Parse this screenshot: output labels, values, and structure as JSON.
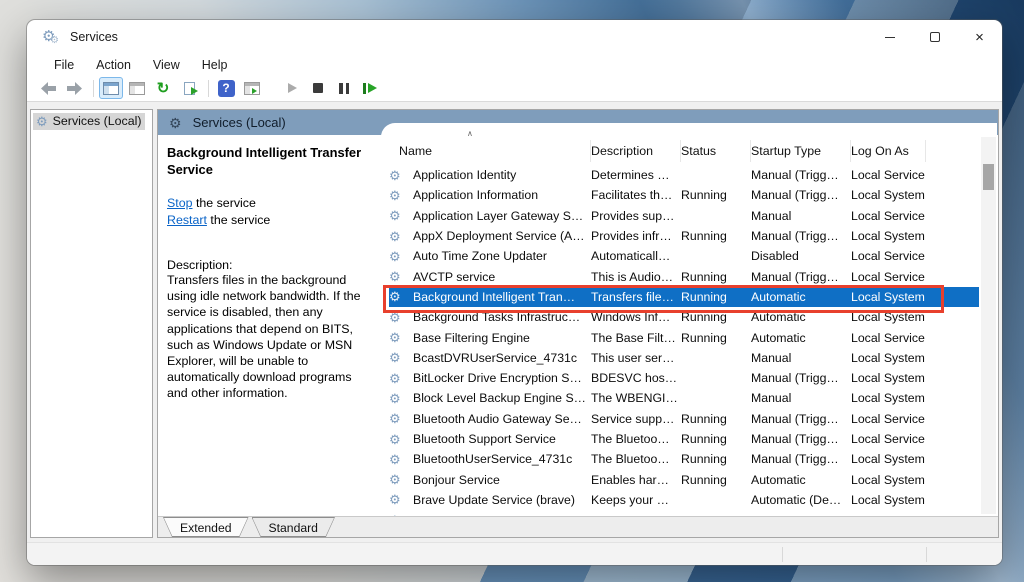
{
  "window": {
    "title": "Services",
    "controls": {
      "minimize": "minimize",
      "maximize": "maximize",
      "close": "×"
    }
  },
  "menu": {
    "items": [
      "File",
      "Action",
      "View",
      "Help"
    ]
  },
  "toolbar": {
    "icons": [
      "back-arrow",
      "forward-arrow",
      "show-console-tree",
      "properties-window",
      "refresh",
      "export-list",
      "help",
      "show-action-pane",
      "start-service",
      "stop-service",
      "pause-service",
      "restart-service"
    ]
  },
  "tree": {
    "items": [
      {
        "label": "Services (Local)",
        "selected": true
      }
    ]
  },
  "panel": {
    "header": "Services (Local)",
    "service": {
      "title": "Background Intelligent Transfer Service",
      "actions": [
        {
          "link": "Stop",
          "rest": " the service"
        },
        {
          "link": "Restart",
          "rest": " the service"
        }
      ],
      "description_label": "Description:",
      "description": "Transfers files in the background using idle network bandwidth. If the service is disabled, then any applications that depend on BITS, such as Windows Update or MSN Explorer, will be unable to automatically download programs and other information."
    }
  },
  "table": {
    "columns": [
      "Name",
      "Description",
      "Status",
      "Startup Type",
      "Log On As"
    ],
    "sort_caret": "∧",
    "selected_index": 6,
    "rows": [
      {
        "name": "Application Identity",
        "description": "Determines …",
        "status": "",
        "startup": "Manual (Trigg…",
        "logon": "Local Service"
      },
      {
        "name": "Application Information",
        "description": "Facilitates th…",
        "status": "Running",
        "startup": "Manual (Trigg…",
        "logon": "Local System"
      },
      {
        "name": "Application Layer Gateway S…",
        "description": "Provides sup…",
        "status": "",
        "startup": "Manual",
        "logon": "Local Service"
      },
      {
        "name": "AppX Deployment Service (A…",
        "description": "Provides infr…",
        "status": "Running",
        "startup": "Manual (Trigg…",
        "logon": "Local System"
      },
      {
        "name": "Auto Time Zone Updater",
        "description": "Automaticall…",
        "status": "",
        "startup": "Disabled",
        "logon": "Local Service"
      },
      {
        "name": "AVCTP service",
        "description": "This is Audio…",
        "status": "Running",
        "startup": "Manual (Trigg…",
        "logon": "Local Service"
      },
      {
        "name": "Background Intelligent Tran…",
        "description": "Transfers file…",
        "status": "Running",
        "startup": "Automatic",
        "logon": "Local System"
      },
      {
        "name": "Background Tasks Infrastruc…",
        "description": "Windows Inf…",
        "status": "Running",
        "startup": "Automatic",
        "logon": "Local System"
      },
      {
        "name": "Base Filtering Engine",
        "description": "The Base Filt…",
        "status": "Running",
        "startup": "Automatic",
        "logon": "Local Service"
      },
      {
        "name": "BcastDVRUserService_4731c",
        "description": "This user ser…",
        "status": "",
        "startup": "Manual",
        "logon": "Local System"
      },
      {
        "name": "BitLocker Drive Encryption S…",
        "description": "BDESVC hos…",
        "status": "",
        "startup": "Manual (Trigg…",
        "logon": "Local System"
      },
      {
        "name": "Block Level Backup Engine S…",
        "description": "The WBENGI…",
        "status": "",
        "startup": "Manual",
        "logon": "Local System"
      },
      {
        "name": "Bluetooth Audio Gateway Se…",
        "description": "Service supp…",
        "status": "Running",
        "startup": "Manual (Trigg…",
        "logon": "Local Service"
      },
      {
        "name": "Bluetooth Support Service",
        "description": "The Bluetoo…",
        "status": "Running",
        "startup": "Manual (Trigg…",
        "logon": "Local Service"
      },
      {
        "name": "BluetoothUserService_4731c",
        "description": "The Bluetoo…",
        "status": "Running",
        "startup": "Manual (Trigg…",
        "logon": "Local System"
      },
      {
        "name": "Bonjour Service",
        "description": "Enables har…",
        "status": "Running",
        "startup": "Automatic",
        "logon": "Local System"
      },
      {
        "name": "Brave Update Service (brave)",
        "description": "Keeps your …",
        "status": "",
        "startup": "Automatic (De…",
        "logon": "Local System"
      },
      {
        "name": "",
        "description": "",
        "status": "",
        "startup": "",
        "logon": "",
        "partial": true
      }
    ]
  },
  "tabs": {
    "items": [
      {
        "label": "Extended",
        "active": true
      },
      {
        "label": "Standard",
        "active": false
      }
    ]
  },
  "colors": {
    "selection": "#0f6fc5",
    "highlight_box": "#e8402d",
    "header_strip": "#7f9dbb",
    "link": "#0a64c8"
  }
}
